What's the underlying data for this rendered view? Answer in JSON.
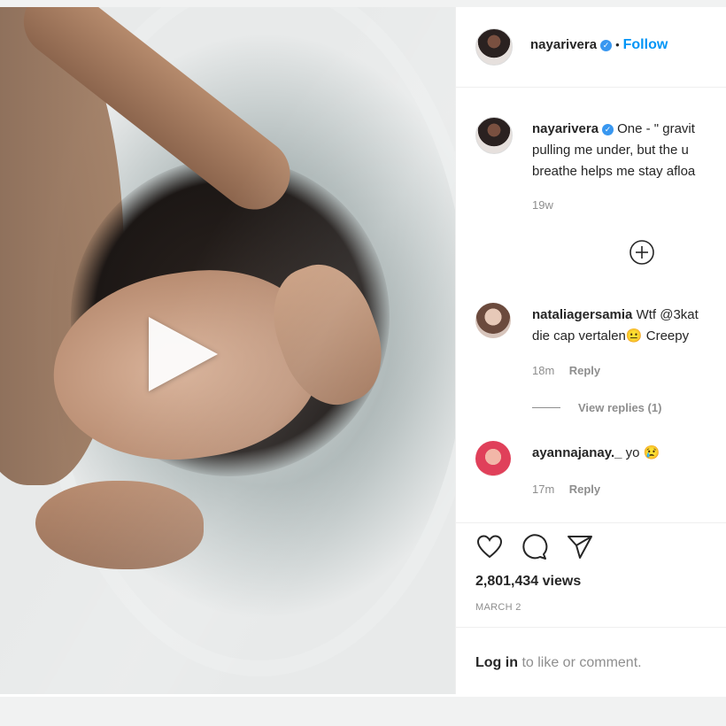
{
  "post": {
    "author": "nayarivera",
    "follow_label": "Follow",
    "dot": "•",
    "verified_glyph": "✓",
    "caption_lines": [
      "One - \" gravit",
      "pulling me under, but the u",
      "breathe helps me stay afloa"
    ],
    "caption_age": "19w",
    "load_more_icon": "plus-circle-icon",
    "play_icon": "play-icon"
  },
  "comments": [
    {
      "username": "nataliagersamia",
      "text_lines": [
        "Wtf @3kat",
        "die cap vertalen😐 Creepy"
      ],
      "age": "18m",
      "reply_label": "Reply",
      "view_replies_label": "View replies (1)"
    },
    {
      "username": "ayannajanay._",
      "text": "yo 😢",
      "age": "17m",
      "reply_label": "Reply"
    }
  ],
  "actions": {
    "icons": [
      "heart-icon",
      "comment-icon",
      "share-icon"
    ],
    "views": "2,801,434 views",
    "date": "MARCH 2"
  },
  "login": {
    "link": "Log in",
    "rest": "to like or comment."
  }
}
